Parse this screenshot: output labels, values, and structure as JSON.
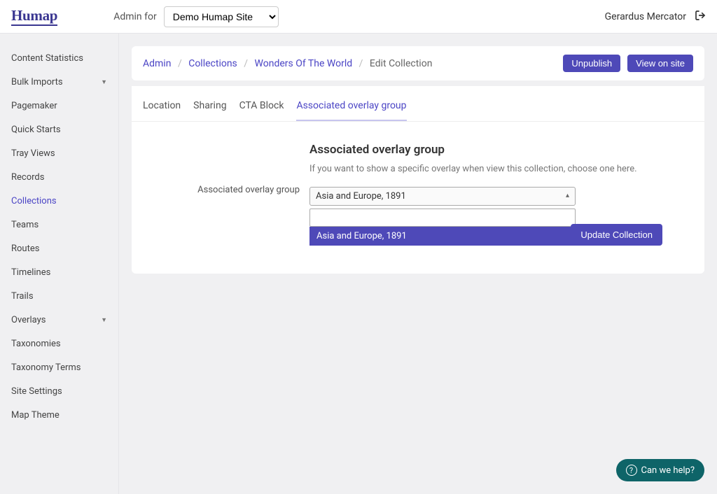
{
  "topbar": {
    "logo": "Humap",
    "admin_for": "Admin for",
    "selected_site": "Demo Humap Site",
    "username": "Gerardus Mercator"
  },
  "sidebar": {
    "items": [
      {
        "label": "Content Statistics",
        "expandable": false
      },
      {
        "label": "Bulk Imports",
        "expandable": true
      },
      {
        "label": "Pagemaker",
        "expandable": false
      },
      {
        "label": "Quick Starts",
        "expandable": false
      },
      {
        "label": "Tray Views",
        "expandable": false
      },
      {
        "label": "Records",
        "expandable": false
      },
      {
        "label": "Collections",
        "expandable": false,
        "active": true
      },
      {
        "label": "Teams",
        "expandable": false
      },
      {
        "label": "Routes",
        "expandable": false
      },
      {
        "label": "Timelines",
        "expandable": false
      },
      {
        "label": "Trails",
        "expandable": false
      },
      {
        "label": "Overlays",
        "expandable": true
      },
      {
        "label": "Taxonomies",
        "expandable": false
      },
      {
        "label": "Taxonomy Terms",
        "expandable": false
      },
      {
        "label": "Site Settings",
        "expandable": false
      },
      {
        "label": "Map Theme",
        "expandable": false
      }
    ]
  },
  "breadcrumbs": {
    "admin": "Admin",
    "collections": "Collections",
    "record": "Wonders Of The World",
    "current": "Edit Collection"
  },
  "actions": {
    "unpublish": "Unpublish",
    "view_on_site": "View on site",
    "update": "Update Collection"
  },
  "tabs": [
    {
      "label": "Location"
    },
    {
      "label": "Sharing"
    },
    {
      "label": "CTA Block"
    },
    {
      "label": "Associated overlay group",
      "active": true
    }
  ],
  "panel": {
    "title": "Associated overlay group",
    "description": "If you want to show a specific overlay when view this collection, choose one here.",
    "field_label": "Associated overlay group",
    "selected": "Asia and Europe, 1891",
    "search_value": "",
    "dropdown_option": "Asia and Europe, 1891"
  },
  "help": {
    "label": "Can we help?"
  }
}
